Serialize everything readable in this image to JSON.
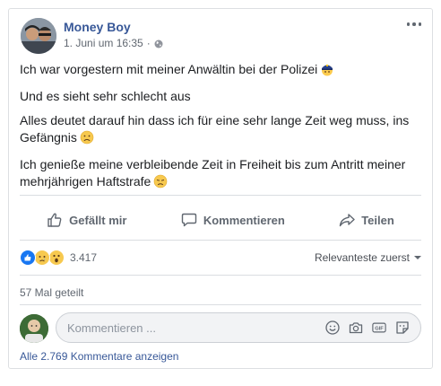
{
  "post": {
    "author": "Money Boy",
    "date": "1. Juni um 16:35",
    "lines": [
      "Ich war vorgestern mit meiner Anwältin bei der Polizei",
      "Und es sieht sehr schlecht aus",
      "Alles deutet darauf hin dass ich für eine sehr lange Zeit weg muss, ins Gefängnis",
      "Ich genieße meine verbleibende Zeit in Freiheit bis zum Antritt meiner mehrjährigen Haftstrafe"
    ],
    "emojis": [
      "police-officer-emoji",
      "frowning-face-emoji",
      "disappointed-face-emoji"
    ]
  },
  "actions": {
    "like": "Gefällt mir",
    "comment": "Kommentieren",
    "share": "Teilen"
  },
  "stats": {
    "reaction_icons": [
      "like-reaction-icon",
      "sad-reaction-icon",
      "wow-reaction-icon"
    ],
    "reaction_count": "3.417",
    "sort_label": "Relevanteste zuerst",
    "shares": "57 Mal geteilt"
  },
  "comment_box": {
    "placeholder": "Kommentieren ...",
    "icons": [
      "emoji-icon",
      "camera-icon",
      "gif-icon",
      "sticker-icon"
    ]
  },
  "all_comments": "Alle 2.769 Kommentare anzeigen",
  "colors": {
    "link_blue": "#385898",
    "meta_gray": "#606770",
    "like_blue": "#1877f2",
    "reaction_yellow": "#f7c94f"
  }
}
